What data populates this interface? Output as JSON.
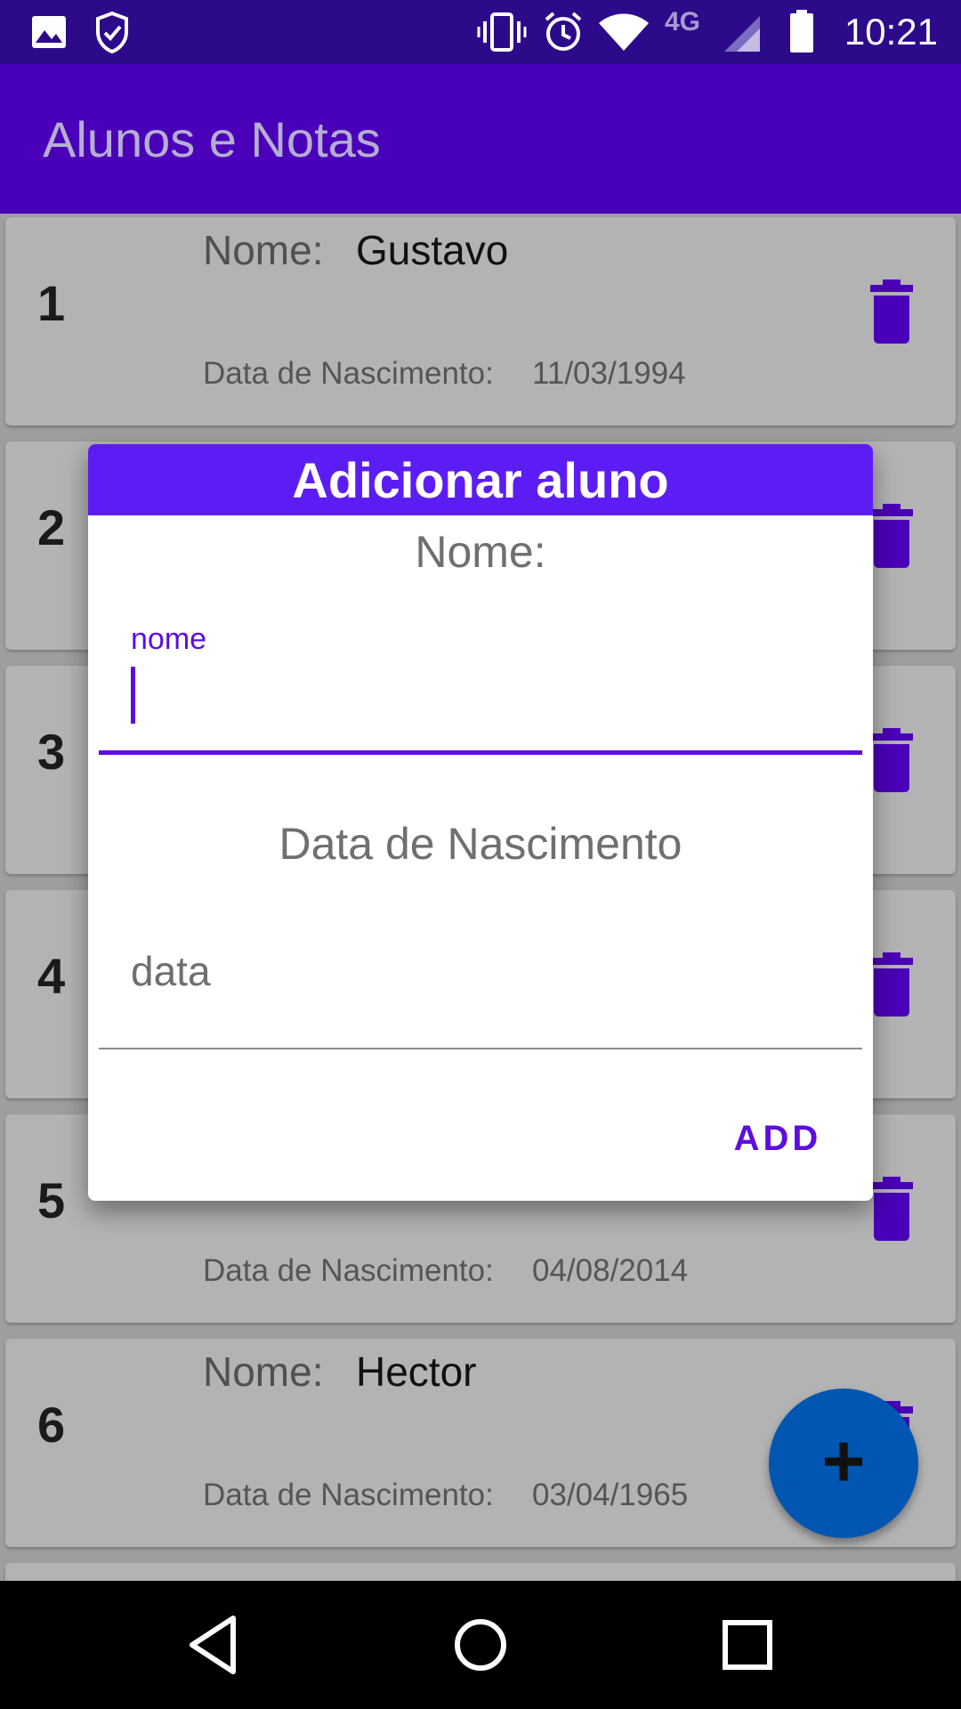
{
  "status_bar": {
    "time": "10:21",
    "network": "4G",
    "icons": [
      "image-icon",
      "shield-check-icon",
      "vibrate-icon",
      "alarm-icon",
      "wifi-icon",
      "signal-icon",
      "battery-icon"
    ]
  },
  "app_bar": {
    "title": "Alunos e Notas"
  },
  "list": {
    "name_label": "Nome:",
    "date_label": "Data de Nascimento:",
    "items": [
      {
        "number": "1",
        "name": "Gustavo",
        "date": "11/03/1994"
      },
      {
        "number": "2",
        "name": "",
        "date": ""
      },
      {
        "number": "3",
        "name": "",
        "date": ""
      },
      {
        "number": "4",
        "name": "",
        "date": ""
      },
      {
        "number": "5",
        "name": "",
        "date": "04/08/2014"
      },
      {
        "number": "6",
        "name": "Hector",
        "date": "03/04/1965"
      }
    ]
  },
  "dialog": {
    "title": "Adicionar aluno",
    "nome_heading": "Nome:",
    "nome_floating_label": "nome",
    "nome_value": "",
    "data_heading": "Data de Nascimento",
    "data_placeholder": "data",
    "add_label": "ADD"
  },
  "fab": {
    "icon": "plus-icon",
    "label": "+"
  },
  "colors": {
    "status_bar": "#2d0a8a",
    "app_bar": "#4a00b8",
    "accent": "#5d0de0",
    "dialog_title": "#5c1df5",
    "fab": "#0056b0"
  }
}
